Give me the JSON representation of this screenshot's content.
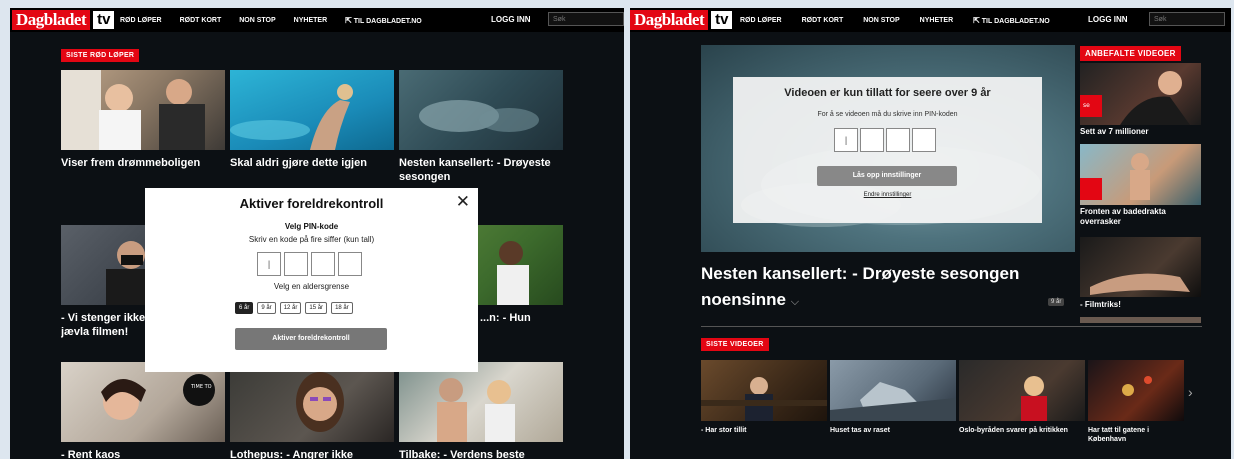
{
  "brand": {
    "logo_text": "Dagbladet",
    "logo_tv": "tv"
  },
  "nav": {
    "items": [
      "RØD LØPER",
      "RØDT KORT",
      "NON STOP",
      "NYHETER"
    ],
    "external": "TIL DAGBLADET.NO",
    "login": "LOGG INN",
    "search_placeholder": "Søk"
  },
  "left": {
    "section_label": "SISTE RØD LØPER",
    "captions": [
      "Viser frem drømmeboligen",
      "Skal aldri gjøre dette igjen",
      "Nesten kansellert: - Drøyeste sesongen",
      "- Vi stenger ikke - jævla filmen!",
      "...n: - Hun",
      "- Rent kaos",
      "Lothepus: - Angrer ikke",
      "Tilbake: - Verdens beste"
    ],
    "modal": {
      "title": "Aktiver foreldrekontroll",
      "close": "✕",
      "subtitle": "Velg PIN-kode",
      "description": "Skriv en kode på fire siffer (kun tall)",
      "pin_first": "|",
      "age_label": "Velg en aldersgrense",
      "ages": [
        "6 år",
        "9 år",
        "12 år",
        "15 år",
        "18 år"
      ],
      "selected_age": "6 år",
      "button": "Aktiver foreldrekontroll"
    }
  },
  "right": {
    "video_modal": {
      "title": "Videoen er kun tillatt for seere over 9 år",
      "description": "For å se videoen må du skrive inn PIN-koden",
      "pin_first": "|",
      "button": "Lås opp innstillinger",
      "link": "Endre innstillinger"
    },
    "video_title": "Nesten kansellert: - Drøyeste sesongen noensinne",
    "chevron": "⌵",
    "age_badge": "9 år",
    "recommended_label": "ANBEFALTE VIDEOER",
    "recommended": [
      "Sett av 7 millioner",
      "Fronten av badedrakta overrasker",
      "- Filmtriks!"
    ],
    "latest_label": "SISTE VIDEOER",
    "latest": [
      "- Har stor tillit",
      "Huset tas av raset",
      "Oslo-byråden svarer på kritikken",
      "Har tatt til gatene i København"
    ],
    "next_arrow": "›"
  },
  "colors": {
    "accent": "#e30613",
    "background": "#0c1014"
  }
}
